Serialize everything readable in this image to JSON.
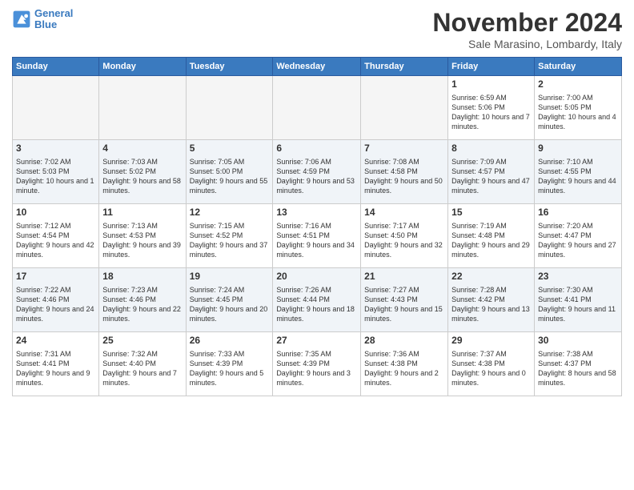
{
  "logo": {
    "text1": "General",
    "text2": "Blue"
  },
  "title": "November 2024",
  "location": "Sale Marasino, Lombardy, Italy",
  "days_of_week": [
    "Sunday",
    "Monday",
    "Tuesday",
    "Wednesday",
    "Thursday",
    "Friday",
    "Saturday"
  ],
  "weeks": [
    [
      {
        "day": "",
        "info": ""
      },
      {
        "day": "",
        "info": ""
      },
      {
        "day": "",
        "info": ""
      },
      {
        "day": "",
        "info": ""
      },
      {
        "day": "",
        "info": ""
      },
      {
        "day": "1",
        "info": "Sunrise: 6:59 AM\nSunset: 5:06 PM\nDaylight: 10 hours and 7 minutes."
      },
      {
        "day": "2",
        "info": "Sunrise: 7:00 AM\nSunset: 5:05 PM\nDaylight: 10 hours and 4 minutes."
      }
    ],
    [
      {
        "day": "3",
        "info": "Sunrise: 7:02 AM\nSunset: 5:03 PM\nDaylight: 10 hours and 1 minute."
      },
      {
        "day": "4",
        "info": "Sunrise: 7:03 AM\nSunset: 5:02 PM\nDaylight: 9 hours and 58 minutes."
      },
      {
        "day": "5",
        "info": "Sunrise: 7:05 AM\nSunset: 5:00 PM\nDaylight: 9 hours and 55 minutes."
      },
      {
        "day": "6",
        "info": "Sunrise: 7:06 AM\nSunset: 4:59 PM\nDaylight: 9 hours and 53 minutes."
      },
      {
        "day": "7",
        "info": "Sunrise: 7:08 AM\nSunset: 4:58 PM\nDaylight: 9 hours and 50 minutes."
      },
      {
        "day": "8",
        "info": "Sunrise: 7:09 AM\nSunset: 4:57 PM\nDaylight: 9 hours and 47 minutes."
      },
      {
        "day": "9",
        "info": "Sunrise: 7:10 AM\nSunset: 4:55 PM\nDaylight: 9 hours and 44 minutes."
      }
    ],
    [
      {
        "day": "10",
        "info": "Sunrise: 7:12 AM\nSunset: 4:54 PM\nDaylight: 9 hours and 42 minutes."
      },
      {
        "day": "11",
        "info": "Sunrise: 7:13 AM\nSunset: 4:53 PM\nDaylight: 9 hours and 39 minutes."
      },
      {
        "day": "12",
        "info": "Sunrise: 7:15 AM\nSunset: 4:52 PM\nDaylight: 9 hours and 37 minutes."
      },
      {
        "day": "13",
        "info": "Sunrise: 7:16 AM\nSunset: 4:51 PM\nDaylight: 9 hours and 34 minutes."
      },
      {
        "day": "14",
        "info": "Sunrise: 7:17 AM\nSunset: 4:50 PM\nDaylight: 9 hours and 32 minutes."
      },
      {
        "day": "15",
        "info": "Sunrise: 7:19 AM\nSunset: 4:48 PM\nDaylight: 9 hours and 29 minutes."
      },
      {
        "day": "16",
        "info": "Sunrise: 7:20 AM\nSunset: 4:47 PM\nDaylight: 9 hours and 27 minutes."
      }
    ],
    [
      {
        "day": "17",
        "info": "Sunrise: 7:22 AM\nSunset: 4:46 PM\nDaylight: 9 hours and 24 minutes."
      },
      {
        "day": "18",
        "info": "Sunrise: 7:23 AM\nSunset: 4:46 PM\nDaylight: 9 hours and 22 minutes."
      },
      {
        "day": "19",
        "info": "Sunrise: 7:24 AM\nSunset: 4:45 PM\nDaylight: 9 hours and 20 minutes."
      },
      {
        "day": "20",
        "info": "Sunrise: 7:26 AM\nSunset: 4:44 PM\nDaylight: 9 hours and 18 minutes."
      },
      {
        "day": "21",
        "info": "Sunrise: 7:27 AM\nSunset: 4:43 PM\nDaylight: 9 hours and 15 minutes."
      },
      {
        "day": "22",
        "info": "Sunrise: 7:28 AM\nSunset: 4:42 PM\nDaylight: 9 hours and 13 minutes."
      },
      {
        "day": "23",
        "info": "Sunrise: 7:30 AM\nSunset: 4:41 PM\nDaylight: 9 hours and 11 minutes."
      }
    ],
    [
      {
        "day": "24",
        "info": "Sunrise: 7:31 AM\nSunset: 4:41 PM\nDaylight: 9 hours and 9 minutes."
      },
      {
        "day": "25",
        "info": "Sunrise: 7:32 AM\nSunset: 4:40 PM\nDaylight: 9 hours and 7 minutes."
      },
      {
        "day": "26",
        "info": "Sunrise: 7:33 AM\nSunset: 4:39 PM\nDaylight: 9 hours and 5 minutes."
      },
      {
        "day": "27",
        "info": "Sunrise: 7:35 AM\nSunset: 4:39 PM\nDaylight: 9 hours and 3 minutes."
      },
      {
        "day": "28",
        "info": "Sunrise: 7:36 AM\nSunset: 4:38 PM\nDaylight: 9 hours and 2 minutes."
      },
      {
        "day": "29",
        "info": "Sunrise: 7:37 AM\nSunset: 4:38 PM\nDaylight: 9 hours and 0 minutes."
      },
      {
        "day": "30",
        "info": "Sunrise: 7:38 AM\nSunset: 4:37 PM\nDaylight: 8 hours and 58 minutes."
      }
    ]
  ]
}
